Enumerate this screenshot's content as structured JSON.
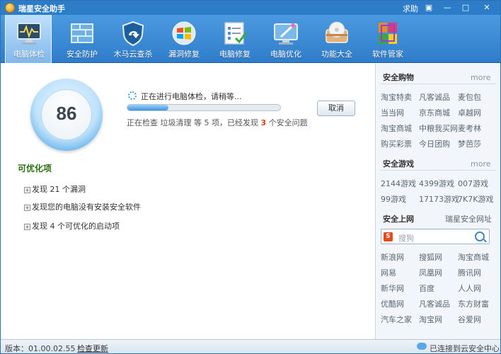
{
  "window": {
    "title": "瑞星安全助手",
    "help": "求助"
  },
  "window_buttons": [
    "▣",
    "—",
    "□",
    "✕"
  ],
  "toolbar": [
    {
      "label": "电脑体检",
      "icon": "monitor-pulse-icon",
      "active": true
    },
    {
      "label": "安全防护",
      "icon": "firewall-icon",
      "active": false
    },
    {
      "label": "木马云查杀",
      "icon": "shield-cloud-icon",
      "active": false
    },
    {
      "label": "漏洞修复",
      "icon": "windows-logo-icon",
      "active": false
    },
    {
      "label": "电脑修复",
      "icon": "checklist-icon",
      "active": false
    },
    {
      "label": "电脑优化",
      "icon": "magic-wand-monitor-icon",
      "active": false
    },
    {
      "label": "功能大全",
      "icon": "toolbox-disc-icon",
      "active": false
    },
    {
      "label": "软件管家",
      "icon": "colorful-blocks-icon",
      "active": false
    }
  ],
  "scan": {
    "score": "86",
    "status": "正在进行电脑体检，请稍等...",
    "progress": 0.27,
    "detail_prefix": "正在检查 垃圾清理 等 5 项，已经发现",
    "found_count": "3",
    "detail_suffix": "个安全问题",
    "cancel": "取消"
  },
  "optimizable": {
    "title": "可优化项",
    "items": [
      "发现 21 个漏洞",
      "发现您的电脑没有安装安全软件",
      "发现 4 个可优化的启动项"
    ]
  },
  "sidebar": {
    "shopping": {
      "title": "安全购物",
      "more": "more",
      "links": [
        "淘宝特卖",
        "凡客诚品",
        "麦包包",
        "当当网",
        "京东商城",
        "卓越网",
        "淘宝商城",
        "中粮我买网",
        "麦考林",
        "购买彩票",
        "今日团购",
        "梦芭莎"
      ]
    },
    "games": {
      "title": "安全游戏",
      "more": "more",
      "links": [
        "2144游戏",
        "4399游戏",
        "007游戏",
        "99游戏",
        "17173游戏",
        "7K7K游戏"
      ]
    },
    "web": {
      "title": "安全上网",
      "right": "瑞星安全网址",
      "search_placeholder": "搜狗",
      "links": [
        "新浪网",
        "搜狐网",
        "淘宝商城",
        "网易",
        "凤凰网",
        "腾讯网",
        "新华网",
        "百度",
        "人人网",
        "优酷网",
        "凡客诚品",
        "东方财富",
        "汽车之家",
        "淘宝网",
        "谷爱网"
      ]
    }
  },
  "statusbar": {
    "version": "版本：01.00.02.55",
    "check_update": "检查更新",
    "cloud": "已连接到云安全中心"
  },
  "colors": {
    "titlebar": "#2d7cc8",
    "toolbar": "#3f8bd6",
    "accent_red": "#e23b1b",
    "opt_green": "#2c6e12"
  }
}
